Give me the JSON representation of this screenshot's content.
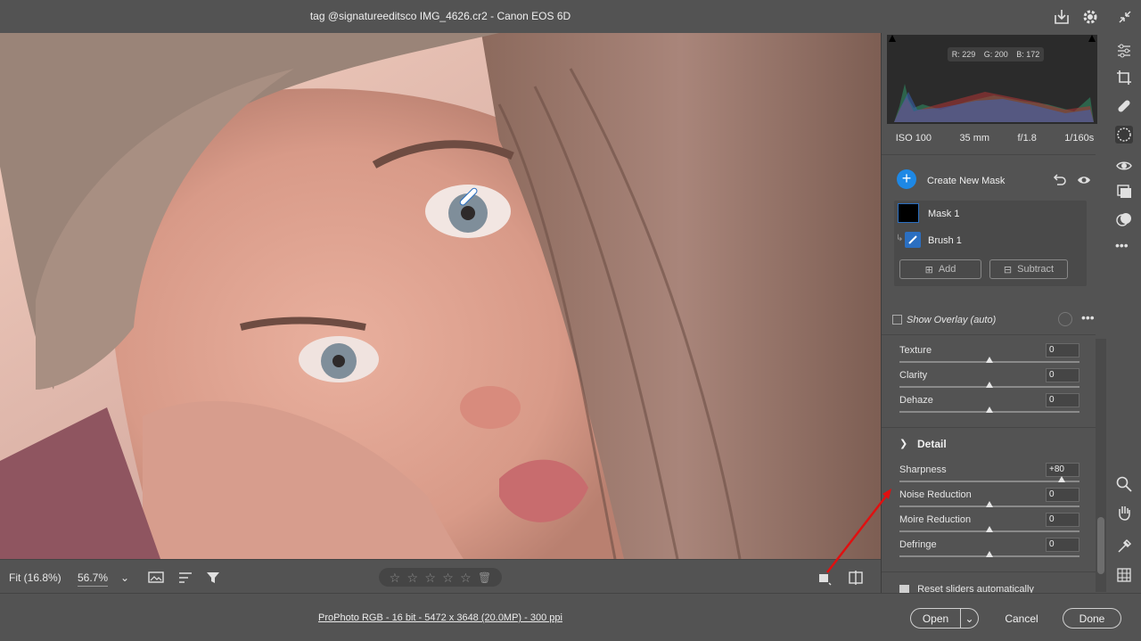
{
  "window": {
    "title": "tag @signatureeditsco IMG_4626.cr2  -  Canon EOS 6D"
  },
  "histogram": {
    "r_label": "R: 229",
    "g_label": "G: 200",
    "b_label": "B: 172"
  },
  "exif": {
    "iso": "ISO 100",
    "focal": "35 mm",
    "aperture": "f/1.8",
    "shutter": "1/160s"
  },
  "masks": {
    "create_label": "Create New Mask",
    "mask_name": "Mask 1",
    "brush_name": "Brush 1",
    "add_label": "Add",
    "subtract_label": "Subtract",
    "show_overlay_label": "Show Overlay (auto)"
  },
  "sliders": [
    {
      "label": "Texture",
      "value": "0",
      "level": 0
    },
    {
      "label": "Clarity",
      "value": "0",
      "level": 0
    },
    {
      "label": "Dehaze",
      "value": "0",
      "level": 0
    }
  ],
  "detail": {
    "title": "Detail",
    "sliders": [
      {
        "label": "Sharpness",
        "value": "+80",
        "level": 80
      },
      {
        "label": "Noise Reduction",
        "value": "0",
        "level": 0
      },
      {
        "label": "Moire Reduction",
        "value": "0",
        "level": 0
      },
      {
        "label": "Defringe",
        "value": "0",
        "level": 0
      }
    ]
  },
  "reset_label": "Reset sliders automatically",
  "canvas_toolbar": {
    "fit_label": "Fit (16.8%)",
    "zoom_value": "56.7%"
  },
  "statusbar": {
    "file_info": "ProPhoto RGB - 16 bit - 5472 x 3648 (20.0MP) - 300 ppi",
    "open_label": "Open",
    "cancel_label": "Cancel",
    "done_label": "Done"
  },
  "colors": {
    "accent": "#1e88e5",
    "panel_bg": "#535353",
    "histogram_bg": "#2b2b2b",
    "annotation_arrow": "#e01010"
  }
}
